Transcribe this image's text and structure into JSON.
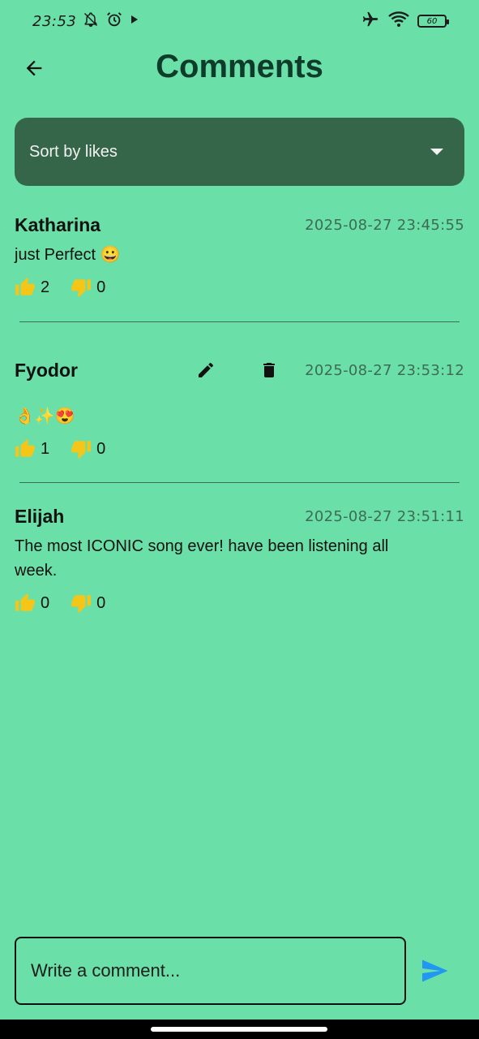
{
  "status": {
    "time": "23:53",
    "battery": "60"
  },
  "header": {
    "title": "Comments"
  },
  "sort": {
    "label": "Sort by likes"
  },
  "comments": [
    {
      "author": "Katharina",
      "time": "2025-08-27 23:45:55",
      "text": "just Perfect 😀",
      "likes": "2",
      "dislikes": "0"
    },
    {
      "author": "Fyodor",
      "time": "2025-08-27 23:53:12",
      "text": "👌✨😍",
      "likes": "1",
      "dislikes": "0"
    },
    {
      "author": "Elijah",
      "time": "2025-08-27 23:51:11",
      "text": "The most ICONIC song ever! have been listening all week.",
      "likes": "0",
      "dislikes": "0"
    }
  ],
  "composer": {
    "placeholder": "Write a comment..."
  },
  "colors": {
    "background": "#6ae0a8",
    "dropdown": "#35664a",
    "vote": "#f5c518",
    "send": "#2196f3"
  }
}
